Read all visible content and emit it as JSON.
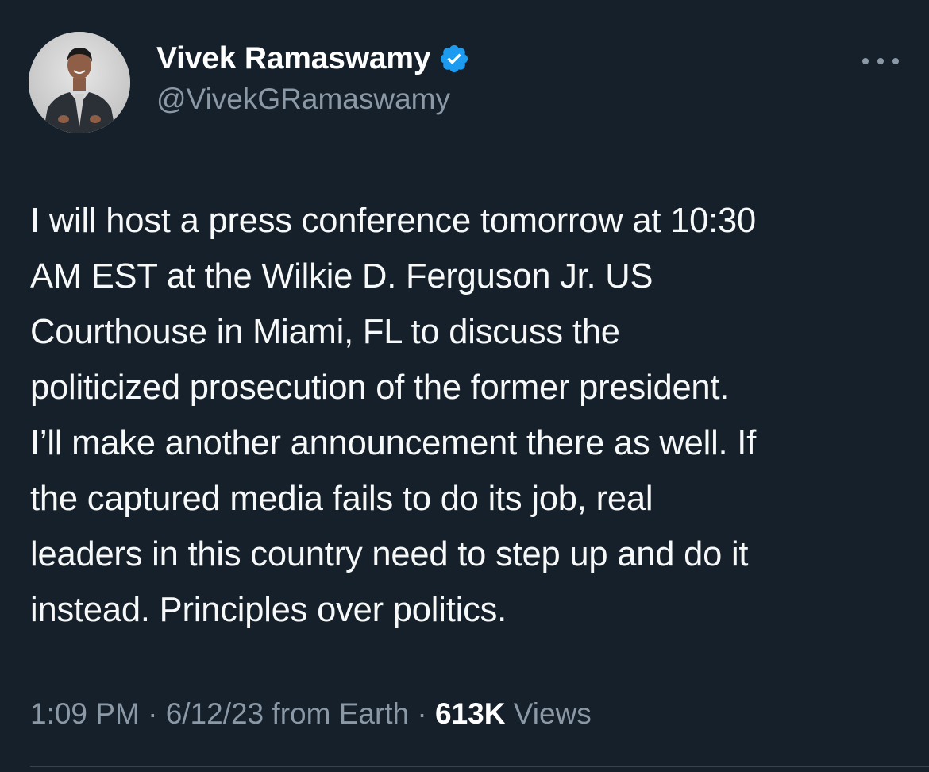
{
  "author": {
    "display_name": "Vivek Ramaswamy",
    "handle": "@VivekGRamaswamy",
    "verified": true,
    "verified_badge_color": "#1d9bf0",
    "avatar_icon": "profile-photo"
  },
  "menu": {
    "icon": "more-options-icon"
  },
  "tweet": {
    "lines": [
      "I will host a press conference tomorrow at 10:30",
      "AM EST at the Wilkie D. Ferguson Jr. US",
      "Courthouse in Miami, FL to discuss the",
      "politicized prosecution of the former president.",
      "I’ll make another announcement there as well. If",
      "the captured media fails to do its job, real",
      "leaders in this country need to step up and do it",
      "instead. Principles over politics."
    ]
  },
  "meta": {
    "time": "1:09 PM",
    "separator": "·",
    "date": "6/12/23",
    "source": "from Earth",
    "views_count": "613K",
    "views_label": "Views"
  },
  "colors": {
    "background": "#15202b",
    "text_primary": "#f7f9f9",
    "text_secondary": "#8b98a5",
    "accent": "#1d9bf0"
  }
}
